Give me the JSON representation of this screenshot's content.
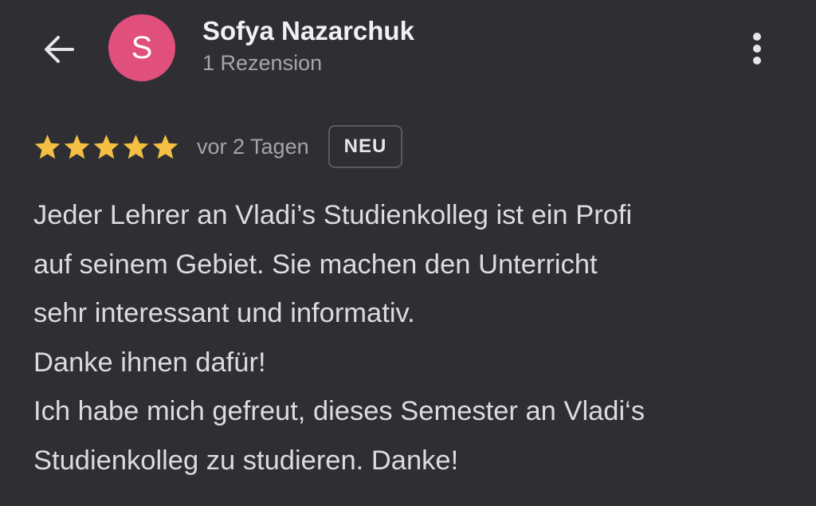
{
  "header": {
    "avatar_letter": "S",
    "avatar_color": "#e14f7d",
    "name": "Sofya Nazarchuk",
    "review_count": "1 Rezension",
    "back_icon": "arrow-left-icon",
    "more_icon": "more-vert-icon"
  },
  "review": {
    "rating": 5,
    "rating_max": 5,
    "star_color": "#f4bf42",
    "date": "vor 2 Tagen",
    "badge": "NEU",
    "lines": [
      "Jeder Lehrer an Vladi’s Studienkolleg ist ein Profi",
      "auf seinem Gebiet. Sie machen den Unterricht",
      "sehr interessant und informativ.",
      "Danke ihnen dafür!",
      "Ich habe mich gefreut, dieses Semester an Vladi‘s",
      "Studienkolleg zu studieren. Danke!"
    ]
  }
}
